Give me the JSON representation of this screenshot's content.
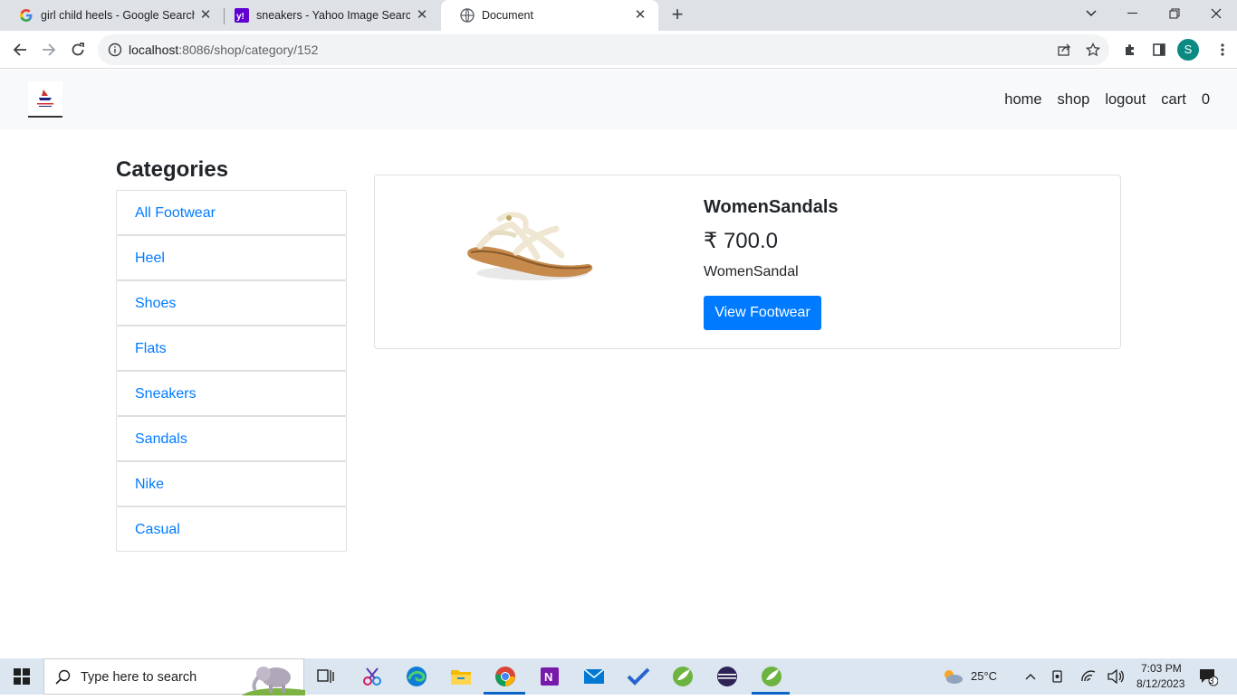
{
  "browser": {
    "tabs": [
      {
        "title": "girl child heels - Google Search",
        "icon": "google-g-icon"
      },
      {
        "title": "sneakers - Yahoo Image Search R",
        "icon": "yahoo-icon"
      },
      {
        "title": "Document",
        "icon": "globe-icon"
      }
    ],
    "url_host": "localhost",
    "url_path": ":8086/shop/category/152",
    "profile_initial": "S"
  },
  "site": {
    "nav": [
      "home",
      "shop",
      "logout",
      "cart",
      "0"
    ]
  },
  "sidebar": {
    "title": "Categories",
    "items": [
      "All Footwear",
      "Heel",
      "Shoes",
      "Flats",
      "Sneakers",
      "Sandals",
      "Nike",
      "Casual"
    ]
  },
  "product": {
    "name": "WomenSandals",
    "price": "₹ 700.0",
    "description": "WomenSandal",
    "button": "View Footwear"
  },
  "taskbar": {
    "search_placeholder": "Type here to search",
    "weather": "25°C",
    "time": "7:03 PM",
    "date": "8/12/2023",
    "notifications": "3"
  },
  "colors": {
    "accent": "#007bff",
    "nav_bg": "#f8f9fa",
    "tab_strip": "#dee1e6"
  }
}
